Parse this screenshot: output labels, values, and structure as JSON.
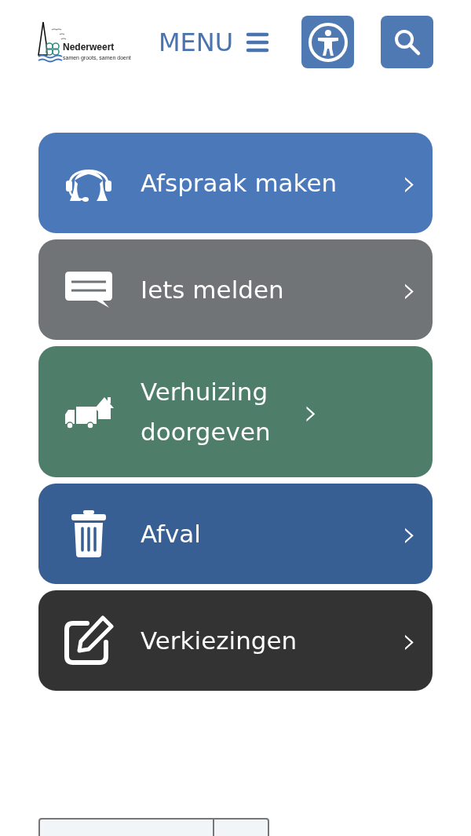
{
  "header": {
    "logo": {
      "name": "Nederweert",
      "tagline": "samen groots, samen doent"
    },
    "menu_label": "MENU"
  },
  "tiles": [
    {
      "label": "Afspraak maken",
      "kind": "headset",
      "color": "#4a78b8",
      "chevron": "›"
    },
    {
      "label": "Iets melden",
      "kind": "message",
      "color": "#707476",
      "chevron": "›"
    },
    {
      "label": "Verhuizing doorgeven",
      "kind": "moving",
      "color": "#4e7e6a",
      "chevron": "›"
    },
    {
      "label": "Afval",
      "kind": "bin",
      "color": "#375f94",
      "chevron": "›"
    },
    {
      "label": "Verkiezingen",
      "kind": "edit",
      "color": "#333333",
      "chevron": "›"
    }
  ]
}
